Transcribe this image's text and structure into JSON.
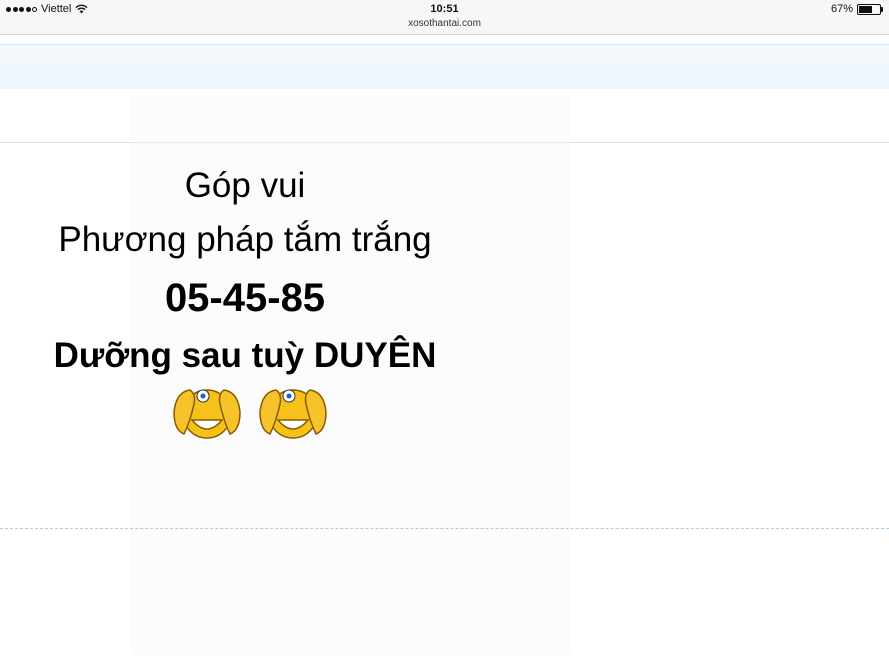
{
  "status_bar": {
    "carrier": "Viettel",
    "time": "10:51",
    "url": "xosothantai.com",
    "battery_percent": "67%",
    "battery_level": 0.67,
    "signal_bars": 4,
    "icons": [
      "signal-dots-icon",
      "wifi-icon",
      "battery-icon"
    ]
  },
  "post": {
    "line1": "Góp vui",
    "line2": "Phương pháp tắm trắng",
    "numbers": "05-45-85",
    "line4": "Dưỡng sau tuỳ DUYÊN",
    "emojis": [
      "covering-eyes-smiley-icon",
      "covering-eyes-smiley-icon"
    ]
  },
  "colors": {
    "divider": "#cfe3f2",
    "dashed_separator": "#a9cde8",
    "emoji_face": "#f6c21a"
  }
}
